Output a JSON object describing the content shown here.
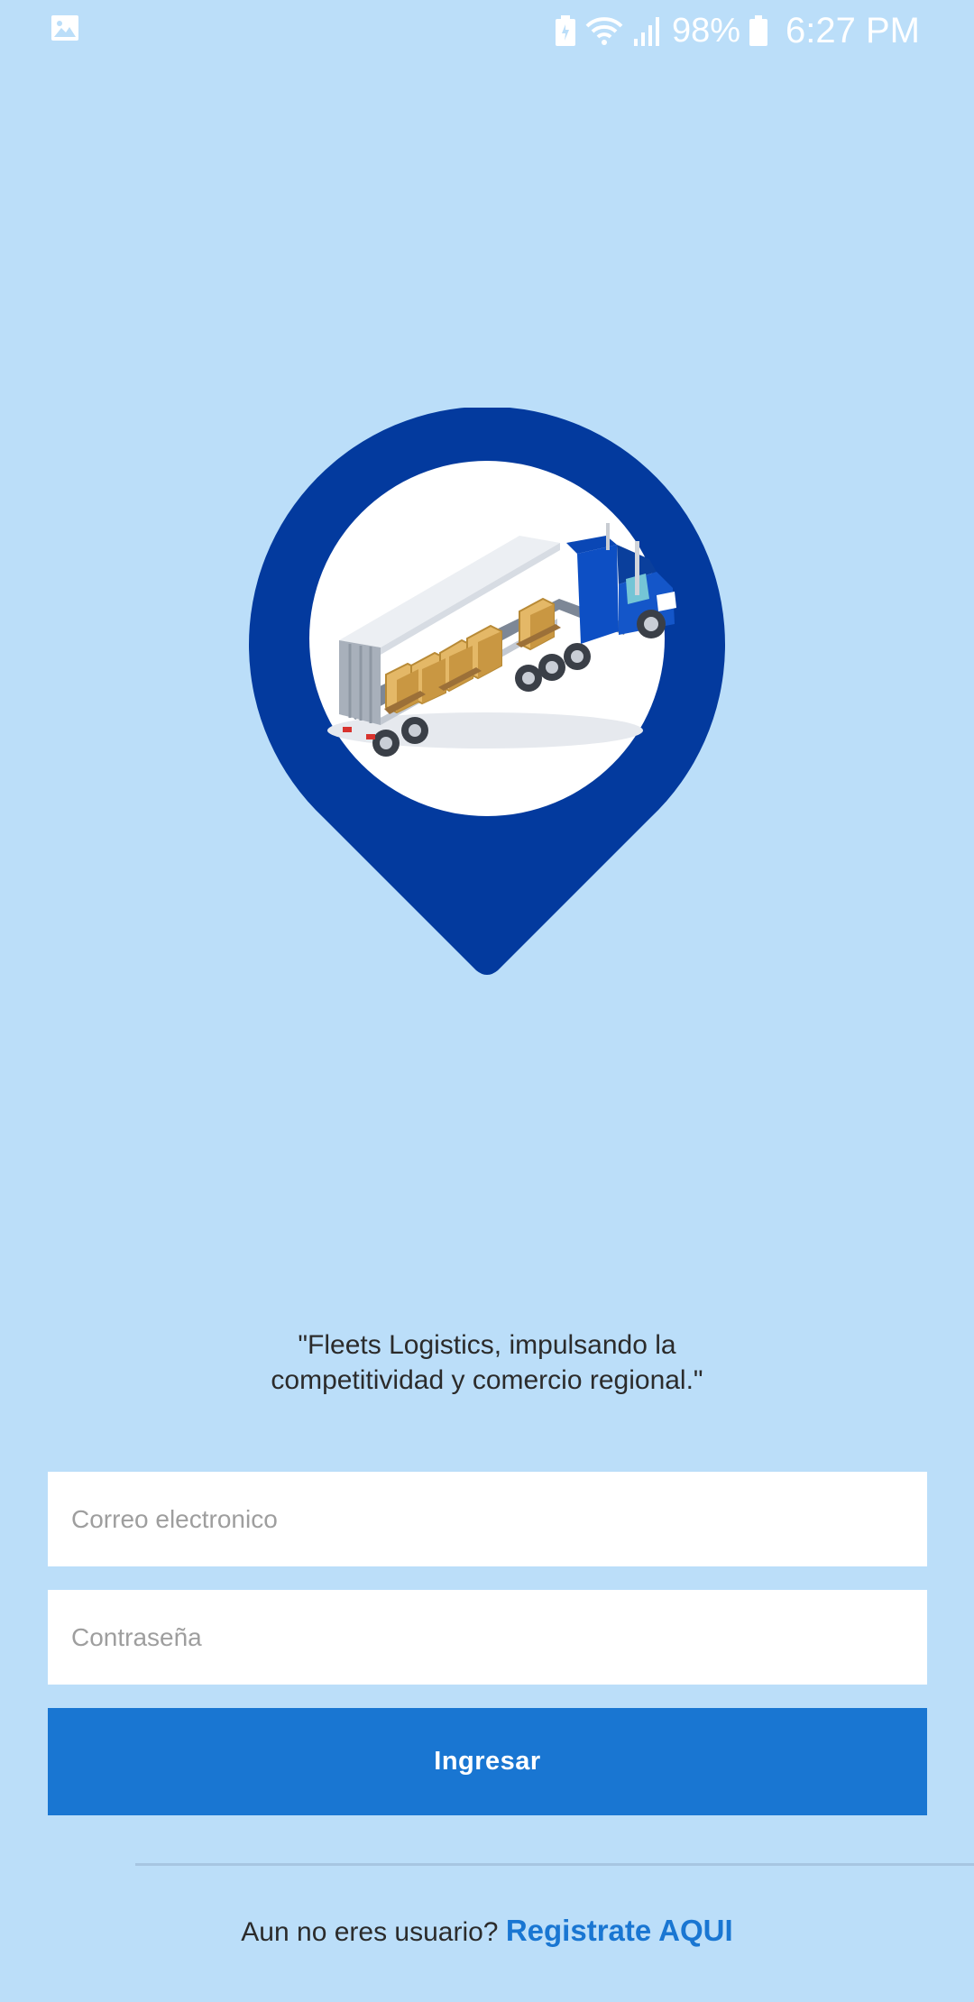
{
  "status_bar": {
    "battery_percent": "98%",
    "time": "6:27 PM",
    "icons": [
      "gallery-icon",
      "battery-saver-icon",
      "wifi-icon",
      "signal-icon",
      "battery-icon"
    ]
  },
  "logo": {
    "icons": [
      "map-pin-icon",
      "truck-icon"
    ],
    "colors": {
      "pin": "#033a9e",
      "circle": "#ffffff"
    }
  },
  "slogan": {
    "line1": "\"Fleets Logistics, impulsando la",
    "line2": "competitividad y comercio regional.\""
  },
  "form": {
    "email_placeholder": "Correo electronico",
    "password_placeholder": "Contraseña",
    "login_label": "Ingresar"
  },
  "register": {
    "prompt": "Aun no eres usuario?",
    "link": "Registrate AQUI"
  },
  "colors": {
    "background": "#bbdef9",
    "primary": "#1976d2"
  }
}
